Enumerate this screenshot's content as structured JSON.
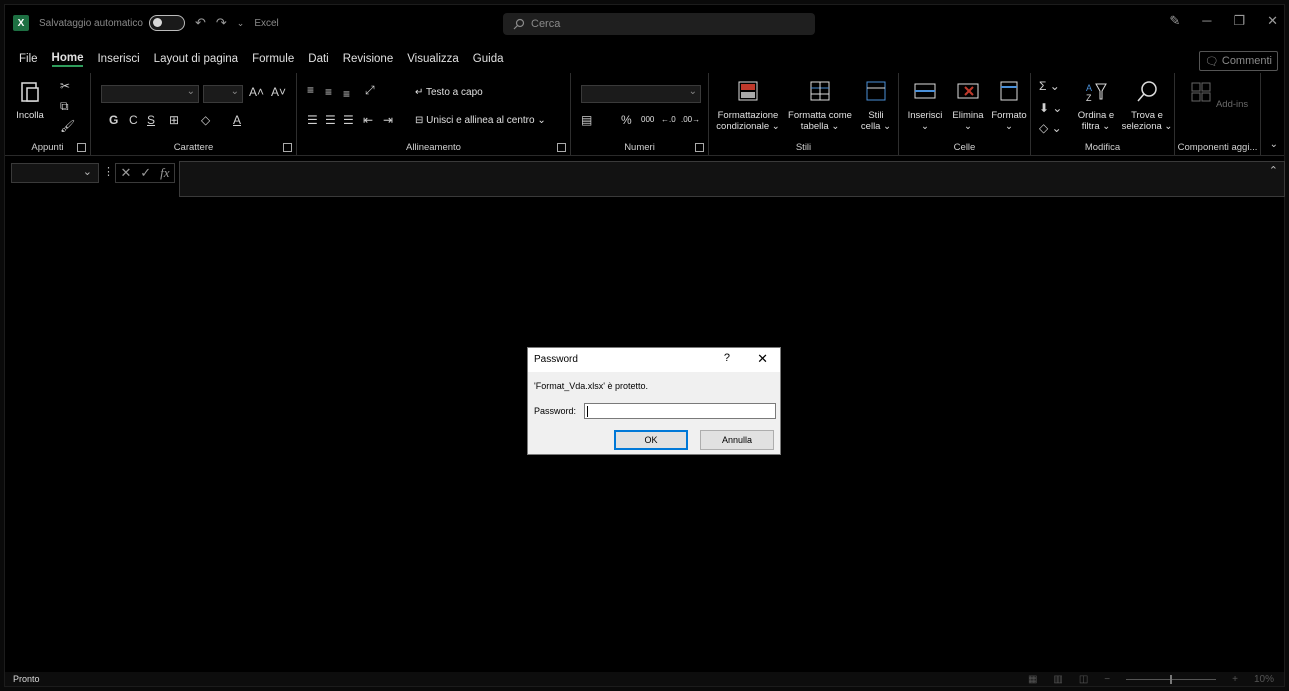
{
  "titlebar": {
    "app_logo": "X",
    "autosave_label": "Salvataggio automatico",
    "app_name": "Excel",
    "search_placeholder": "Cerca"
  },
  "menu": {
    "tabs": [
      "File",
      "Home",
      "Inserisci",
      "Layout di pagina",
      "Formule",
      "Dati",
      "Revisione",
      "Visualizza",
      "Guida"
    ],
    "active_tab": "Home",
    "comments_label": "Commenti"
  },
  "ribbon": {
    "clipboard": {
      "paste_label": "Incolla",
      "group_label": "Appunti"
    },
    "font": {
      "group_label": "Carattere",
      "bold": "G",
      "italic": "C",
      "underline": "S"
    },
    "alignment": {
      "wrap_text": "Testo a capo",
      "merge_center": "Unisci e allinea al centro",
      "group_label": "Allineamento"
    },
    "number": {
      "group_label": "Numeri",
      "percent": "%",
      "thousands": "000"
    },
    "styles": {
      "conditional_1": "Formattazione",
      "conditional_2": "condizionale",
      "table_1": "Formatta come",
      "table_2": "tabella",
      "cell_1": "Stili",
      "cell_2": "cella",
      "group_label": "Stili"
    },
    "cells": {
      "insert": "Inserisci",
      "delete": "Elimina",
      "format": "Formato",
      "group_label": "Celle"
    },
    "editing": {
      "sort_1": "Ordina e",
      "sort_2": "filtra",
      "find_1": "Trova e",
      "find_2": "seleziona",
      "group_label": "Modifica"
    },
    "addins": {
      "label": "Add-ins",
      "group_label": "Componenti aggi..."
    }
  },
  "formula_bar": {
    "fx": "fx"
  },
  "status": {
    "text": "Pronto",
    "zoom": "10%"
  },
  "dialog": {
    "title": "Password",
    "help": "?",
    "message": "'Format_Vda.xlsx' è protetto.",
    "password_label": "Password:",
    "password_value": "",
    "ok_label": "OK",
    "cancel_label": "Annulla"
  }
}
